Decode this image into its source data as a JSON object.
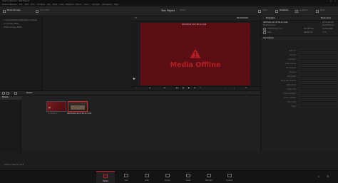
{
  "window": {
    "title": "DaVinci Resolve - Test Project"
  },
  "menu": [
    "DaVinci Resolve",
    "File",
    "Edit",
    "Trim",
    "Timeline",
    "Clip",
    "Mark",
    "View",
    "Playback",
    "Fusion",
    "Color",
    "Fairlight",
    "Workspace",
    "Help"
  ],
  "toolbar": {
    "media_storage": "Media Storage",
    "clone_tool": "Clone Tool",
    "project_title": "Test Project",
    "project_status": "Edited",
    "right_tabs": [
      "Audio",
      "Metadata",
      "Inspector",
      "Mixer"
    ]
  },
  "storage": {
    "locations": [
      "C:\\Users\\Desktop\\Mediapool (Image",
      "C:\\ (Image_MRS)",
      "HDDC (Image_MRN)"
    ]
  },
  "viewer": {
    "fit": "Fit",
    "timecode": "00:00:00:00",
    "clip_name": "2023-09-14 23-39-11.mp4",
    "offline_text": "Media Offline"
  },
  "metadata": {
    "header": "Metadata",
    "pool_label": "Media Pool",
    "clip_file": "2023-09-14 23-39-11.mp4",
    "clip_path": "Media Source",
    "clip_start": "00:00:00:00",
    "clip_end": "00:00:05:23",
    "codec": "H.264 High L5.1",
    "resolution": "1920x1080",
    "fps": "60.000 fps",
    "audio_codec": "AAC",
    "audio_rate": "48000 Hz",
    "audio_ch": "2 ch",
    "section": "Clip Details",
    "fields": [
      "Start TC",
      "End TC",
      "Duration",
      "Start Frame",
      "End Frame",
      "Frames",
      "Bit Depth",
      "Field Dominance",
      "Data Level",
      "Audio Chs",
      "Date Modified",
      "Date Created",
      "Clip Color",
      "Flags"
    ]
  },
  "pool": {
    "header": "Master",
    "bin_master": "Master",
    "smart_bins": "Smart Bins",
    "smart_items": [
      "Keywords",
      "Collections"
    ],
    "clips": [
      {
        "name": "Timeline 1"
      },
      {
        "name": "2023-09-14 23-39-11.mp4"
      }
    ]
  },
  "footer": {
    "app": "DaVinci Resolve 18.6",
    "pages": [
      "Media",
      "Cut",
      "Edit",
      "Fusion",
      "Color",
      "Fairlight",
      "Deliver"
    ],
    "active_page": "Media"
  },
  "colors": {
    "accent": "#c8242a",
    "offline": "#b21f25",
    "frame_bg": "#5a0d12"
  }
}
